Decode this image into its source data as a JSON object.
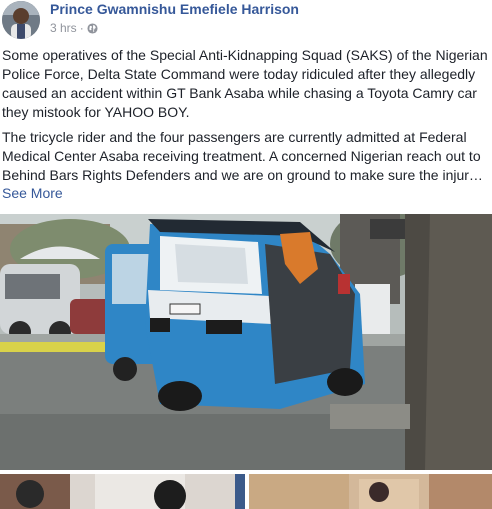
{
  "post": {
    "author": "Prince Gwamnishu Emefiele Harrison",
    "time": "3 hrs",
    "dot": "·",
    "paragraphs": [
      "Some operatives of the Special Anti-Kidnapping Squad (SAKS) of the Nigerian Police Force, Delta State Command were today ridiculed after they allegedly caused an accident within GT Bank Asaba while chasing a Toyota Camry car they mistook for YAHOO BOY.",
      "The tricycle rider and the four passengers are currently admitted at Federal Medical Center Asaba receiving treatment. A concerned Nigerian reach out to Behind Bars Rights Defenders and we are on ground to make sure the injur…"
    ],
    "see_more": "See More"
  },
  "icons": {
    "privacy": "globe-icon"
  },
  "colors": {
    "link": "#365899",
    "meta": "#90949c",
    "text": "#1d2129",
    "keke_blue": "#2f86c6"
  }
}
